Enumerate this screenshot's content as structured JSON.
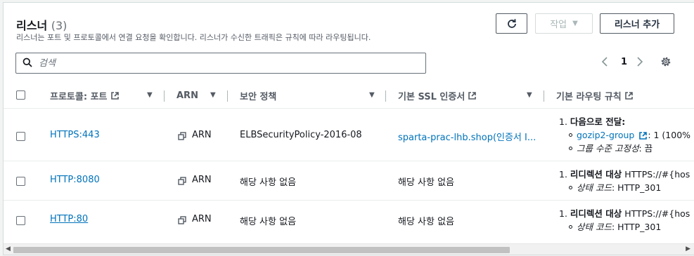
{
  "header": {
    "title": "리스너",
    "count": "(3)",
    "description": "리스너는 포트 및 프로토콜에서 연결 요청을 확인합니다. 리스너가 수신한 트래픽은 규칙에 따라 라우팅됩니다."
  },
  "toolbar": {
    "refresh_icon": "refresh-icon",
    "action_label": "작업",
    "add_label": "리스너 추가"
  },
  "search": {
    "placeholder": "검색",
    "value": ""
  },
  "pagination": {
    "page": "1"
  },
  "columns": {
    "protocol_port": "프로토콜: 포트",
    "arn": "ARN",
    "security_policy": "보안 정책",
    "ssl_cert": "기본 SSL 인증서",
    "routing_rules": "기본 라우팅 규칙"
  },
  "rows": [
    {
      "protocol_port": "HTTPS:443",
      "arn": "ARN",
      "security_policy": "ELBSecurityPolicy-2016-08",
      "ssl_cert": "sparta-prac-lhb.shop(인증서 I...",
      "rule_line1_prefix": "1. ",
      "rule_line1": "다음으로 전달:",
      "rule_target": "gozip2-group",
      "rule_target_suffix": ": 1 (100%",
      "rule_sub_italic": "그룹 수준 고정성",
      "rule_sub_value": ": 끔"
    },
    {
      "protocol_port": "HTTP:8080",
      "arn": "ARN",
      "security_policy": "해당 사항 없음",
      "ssl_cert": "해당 사항 없음",
      "rule_line1_prefix": "1. ",
      "rule_line1": "리디렉션 대상",
      "rule_line1_value": " HTTPS://#{hos",
      "rule_sub_italic": "상태 코드",
      "rule_sub_value": ": HTTP_301"
    },
    {
      "protocol_port": "HTTP:80",
      "arn": "ARN",
      "security_policy": "해당 사항 없음",
      "ssl_cert": "해당 사항 없음",
      "rule_line1_prefix": "1. ",
      "rule_line1": "리디렉션 대상",
      "rule_line1_value": " HTTPS://#{hos",
      "rule_sub_italic": "상태 코드",
      "rule_sub_value": ": HTTP_301"
    }
  ],
  "colors": {
    "link": "#0073bb",
    "text": "#16191f",
    "muted": "#545b64"
  }
}
